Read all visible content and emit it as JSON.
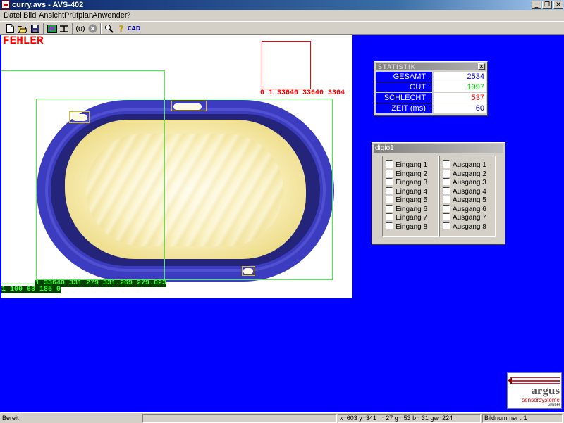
{
  "window": {
    "title": "curry.avs - AVS-402",
    "minimize": "_",
    "restore": "❐",
    "close": "✕"
  },
  "menu": {
    "items": [
      "Datei",
      "Bild",
      "Ansicht",
      "Prüfplan",
      "Anwender",
      "?"
    ]
  },
  "toolbar": {
    "new_icon": "new-file-icon",
    "open_icon": "open-folder-icon",
    "save_icon": "save-disk-icon",
    "image_icon": "image-icon",
    "measure_icon": "measure-icon",
    "signal_icon": "signal-icon",
    "stop_icon": "stop-icon",
    "zoom_icon": "magnifier-icon",
    "help_icon": "help-icon",
    "cad_label": "CAD"
  },
  "image_view": {
    "status_text": "FEHLER",
    "red_roi_readout": "0 1 33640 33640 3364",
    "green_roi_readout": "1 33640 331 279 331.269 279.023",
    "left_roi_readout": "1 100 63 185 0"
  },
  "statistik": {
    "title": "STATISTIK",
    "rows": [
      {
        "label": "GESAMT :",
        "value": "2534",
        "color": "#0000cc"
      },
      {
        "label": "GUT :",
        "value": "1997",
        "color": "#00cc00"
      },
      {
        "label": "SCHLECHT :",
        "value": "537",
        "color": "#ff0000"
      },
      {
        "label": "ZEIT (ms) :",
        "value": "60",
        "color": "#0000cc"
      }
    ]
  },
  "digio": {
    "title": "digio1",
    "inputs": [
      "Eingang 1",
      "Eingang 2",
      "Eingang 3",
      "Eingang 4",
      "Eingang 5",
      "Eingang 6",
      "Eingang 7",
      "Eingang 8"
    ],
    "outputs": [
      "Ausgang 1",
      "Ausgang 2",
      "Ausgang 3",
      "Ausgang 4",
      "Ausgang 5",
      "Ausgang 6",
      "Ausgang 7",
      "Ausgang 8"
    ]
  },
  "logo": {
    "brand": "argus",
    "subtitle": "sensorsysteme",
    "suffix": "GmbH"
  },
  "statusbar": {
    "ready": "Bereit",
    "coords": "x=603  y=341  r= 27  g= 53  b= 31  gw=224",
    "image_number": "Bildnummer : 1"
  },
  "colors": {
    "client_bg": "#0000ff",
    "roi_green": "#33ff33",
    "roi_red": "#ff0000",
    "titlebar": "#0a246a"
  }
}
